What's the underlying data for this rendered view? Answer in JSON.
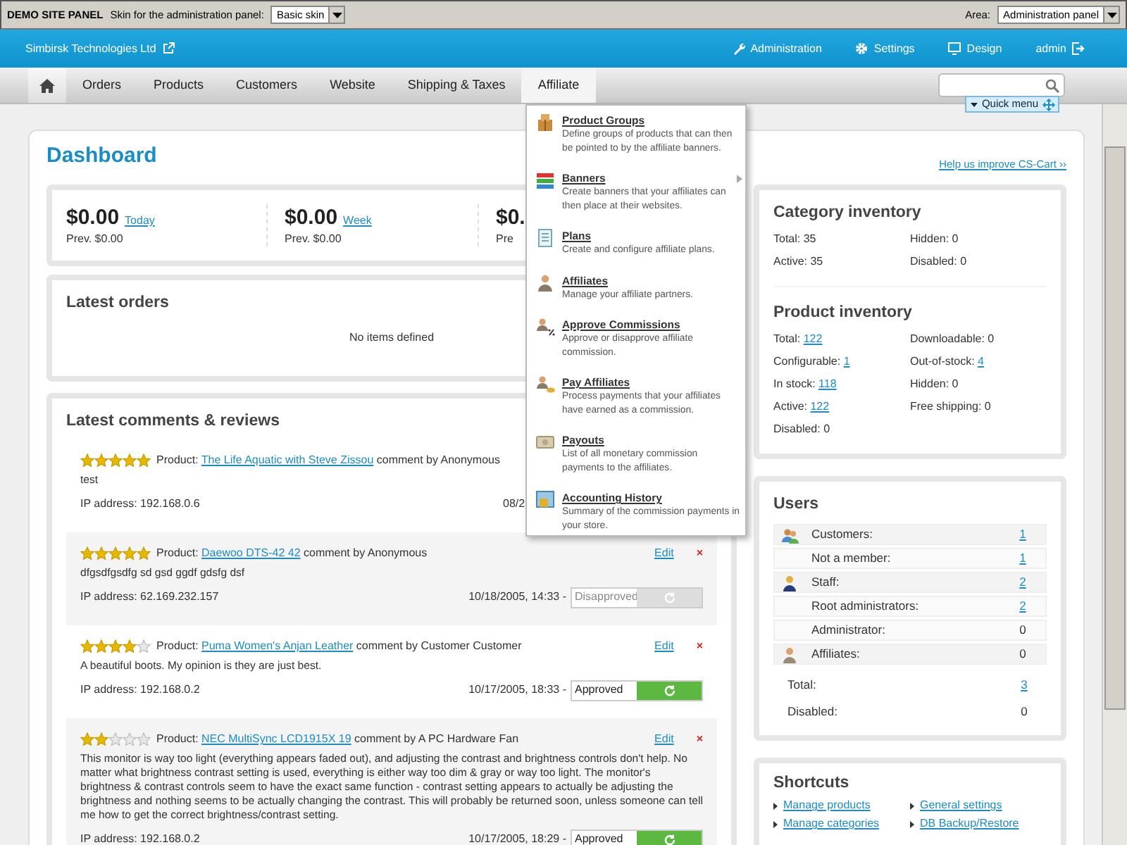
{
  "top_bar": {
    "title": "DEMO SITE PANEL",
    "skin_label": "Skin for the administration panel:",
    "skin_value": "Basic skin",
    "area_label": "Area:",
    "area_value": "Administration panel"
  },
  "header": {
    "company": "Simbirsk Technologies Ltd",
    "links": [
      {
        "label": "Administration",
        "kind": "wrench"
      },
      {
        "label": "Settings",
        "kind": "gear"
      },
      {
        "label": "Design",
        "kind": "monitor"
      },
      {
        "label": "admin",
        "kind": "logout"
      }
    ]
  },
  "nav": {
    "tabs": [
      {
        "kind": "home",
        "selected": true,
        "expanded": false
      },
      {
        "kind": "text",
        "label": "Orders",
        "selected": false,
        "expanded": false
      },
      {
        "kind": "text",
        "label": "Products",
        "selected": false,
        "expanded": false
      },
      {
        "kind": "text",
        "label": "Customers",
        "selected": false,
        "expanded": false
      },
      {
        "kind": "text",
        "label": "Website",
        "selected": false,
        "expanded": false
      },
      {
        "kind": "text",
        "label": "Shipping & Taxes",
        "selected": false,
        "expanded": false
      },
      {
        "kind": "text",
        "label": "Affiliate",
        "selected": false,
        "expanded": true
      }
    ],
    "quick_menu": "Quick menu"
  },
  "affiliate_menu": [
    {
      "kind": "box",
      "title": "Product Groups",
      "description": "Define groups of products that can then be pointed to by the affiliate banners.",
      "submenu": false
    },
    {
      "kind": "banner",
      "title": "Banners",
      "description": "Create banners that your affiliates can then place at their websites.",
      "submenu": true
    },
    {
      "kind": "document",
      "title": "Plans",
      "description": "Create and configure affiliate plans.",
      "submenu": false
    },
    {
      "kind": "person",
      "title": "Affiliates",
      "description": "Manage your affiliate partners.",
      "submenu": false
    },
    {
      "kind": "percent",
      "title": "Approve Commissions",
      "description": "Approve or disapprove affiliate commission.",
      "submenu": false
    },
    {
      "kind": "coins",
      "title": "Pay Affiliates",
      "description": "Process payments that your affiliates have earned as a commission.",
      "submenu": false
    },
    {
      "kind": "money",
      "title": "Payouts",
      "description": "List of all monetary commission payments to the affiliates.",
      "submenu": false
    },
    {
      "kind": "report",
      "title": "Accounting History",
      "description": "Summary of the commission payments in your store.",
      "submenu": false
    }
  ],
  "dashboard": {
    "title": "Dashboard",
    "help_link": "Help us improve CS-Cart ››"
  },
  "stats": [
    {
      "amount": "$0.00",
      "period": "Today",
      "prev": "Prev. $0.00"
    },
    {
      "amount": "$0.00",
      "period": "Week",
      "prev": "Prev. $0.00"
    },
    {
      "amount": "$0.",
      "prev": "Pre"
    }
  ],
  "latest_orders": {
    "title": "Latest orders",
    "empty": "No items defined"
  },
  "comments": {
    "title": "Latest comments & reviews",
    "reviews": [
      {
        "stars": 5,
        "product_label": "Product:",
        "product": "The Life Aquatic with Steve Zissou",
        "author": "comment by Anonymous",
        "text": "test",
        "ip": "IP address: 192.168.0.6",
        "date": "08/2"
      },
      {
        "stars": 5,
        "product_label": "Product:",
        "product": "Daewoo DTS-42 42",
        "author": "comment by Anonymous",
        "text": "dfgsdfgsdfg sd gsd ggdf gdsfg dsf",
        "ip": "IP address: 62.169.232.157",
        "date": "10/18/2005, 14:33 -",
        "status": "Disapproved",
        "approved": false,
        "edit": "Edit",
        "delete": "×"
      },
      {
        "stars": 4,
        "product_label": "Product:",
        "product": "Puma Women's Anjan Leather",
        "author": "comment by Customer Customer",
        "text": "A beautiful boots. My opinion is they are just best.",
        "ip": "IP address: 192.168.0.2",
        "date": "10/17/2005, 18:33 -",
        "status": "Approved",
        "approved": true,
        "edit": "Edit",
        "delete": "×"
      },
      {
        "stars": 2,
        "product_label": "Product:",
        "product": "NEC MultiSync LCD1915X 19",
        "author": "comment by A PC Hardware Fan",
        "text": "This monitor is way too light (everything appears faded out), and adjusting the contrast and brightness controls don't help. No matter what brightness contrast setting is used, everything is either way too dim & gray or way too light. The monitor's brightness & contrast controls seem to have the exact same function - contrast setting appears to actually be adjusting the brightness and nothing seems to be actually changing the contrast. This will probably be returned soon, unless someone can tell me how to get the correct brightness/contrast setting.",
        "ip": "IP address: 192.168.0.2",
        "date": "10/17/2005, 18:29 -",
        "status": "Approved",
        "approved": true,
        "edit": "Edit",
        "delete": "×"
      }
    ]
  },
  "category_inventory": {
    "title": "Category inventory",
    "items": [
      {
        "label": "Total:",
        "value": "35",
        "linked": false
      },
      {
        "label": "Hidden:",
        "value": "0",
        "linked": false
      },
      {
        "label": "Active:",
        "value": "35",
        "linked": false
      },
      {
        "label": "Disabled:",
        "value": "0",
        "linked": false
      }
    ]
  },
  "product_inventory": {
    "title": "Product inventory",
    "items": [
      {
        "label": "Total:",
        "value": "122",
        "linked": true
      },
      {
        "label": "Downloadable:",
        "value": "0",
        "linked": false
      },
      {
        "label": "Configurable:",
        "value": "1",
        "linked": true
      },
      {
        "label": "Out-of-stock:",
        "value": "4",
        "linked": true
      },
      {
        "label": "In stock:",
        "value": "118",
        "linked": true
      },
      {
        "label": "Hidden:",
        "value": "0",
        "linked": false
      },
      {
        "label": "Active:",
        "value": "122",
        "linked": true
      },
      {
        "label": "Free shipping:",
        "value": "0",
        "linked": false
      },
      {
        "label": "Disabled:",
        "value": "0",
        "linked": false
      }
    ]
  },
  "users": {
    "title": "Users",
    "rows": [
      {
        "kind": "customers",
        "label": "Customers:",
        "value": "1",
        "linked": true
      },
      {
        "kind": "sub",
        "label": "Not a member:",
        "value": "1",
        "linked": true
      },
      {
        "kind": "staff",
        "label": "Staff:",
        "value": "2",
        "linked": true
      },
      {
        "kind": "sub",
        "label": "Root administrators:",
        "value": "2",
        "linked": true
      },
      {
        "kind": "sub",
        "label": "Administrator:",
        "value": "0",
        "linked": false
      },
      {
        "kind": "affiliates",
        "label": "Affiliates:",
        "value": "0",
        "linked": false
      }
    ],
    "totals": [
      {
        "label": "Total:",
        "value": "3",
        "linked": true
      },
      {
        "label": "Disabled:",
        "value": "0",
        "linked": false
      }
    ]
  },
  "shortcuts": {
    "title": "Shortcuts",
    "links": [
      "Manage products",
      "General settings",
      "Manage categories",
      "DB Backup/Restore"
    ]
  }
}
